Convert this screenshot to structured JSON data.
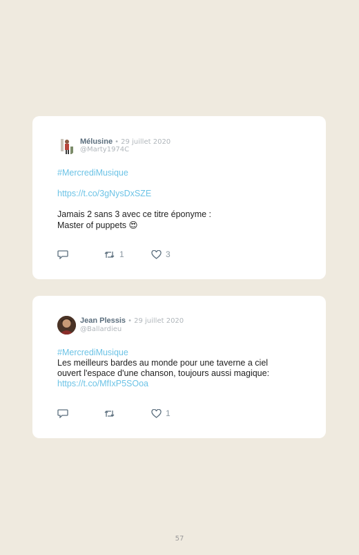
{
  "tweets": [
    {
      "name": "Mélusine",
      "separator": "•",
      "date": "29 juillet 2020",
      "handle": "@Marty1974C",
      "hashtag": "#MercrediMusique",
      "link": "https://t.co/3gNysDxSZE",
      "text_line1": "Jamais 2 sans 3 avec ce titre éponyme :",
      "text_line2": "Master of puppets",
      "emoji": "😍",
      "retweets": "1",
      "likes": "3"
    },
    {
      "name": "Jean Plessis",
      "separator": "•",
      "date": "29 juillet 2020",
      "handle": "@Ballardieu",
      "hashtag": "#MercrediMusique",
      "text_line1": "Les meilleurs bardes au monde pour une taverne a ciel",
      "text_line2": "ouvert l'espace d'une chanson, toujours aussi magique:",
      "link": "https://t.co/MfIxP5SOoa",
      "likes": "1"
    }
  ],
  "page_number": "57"
}
